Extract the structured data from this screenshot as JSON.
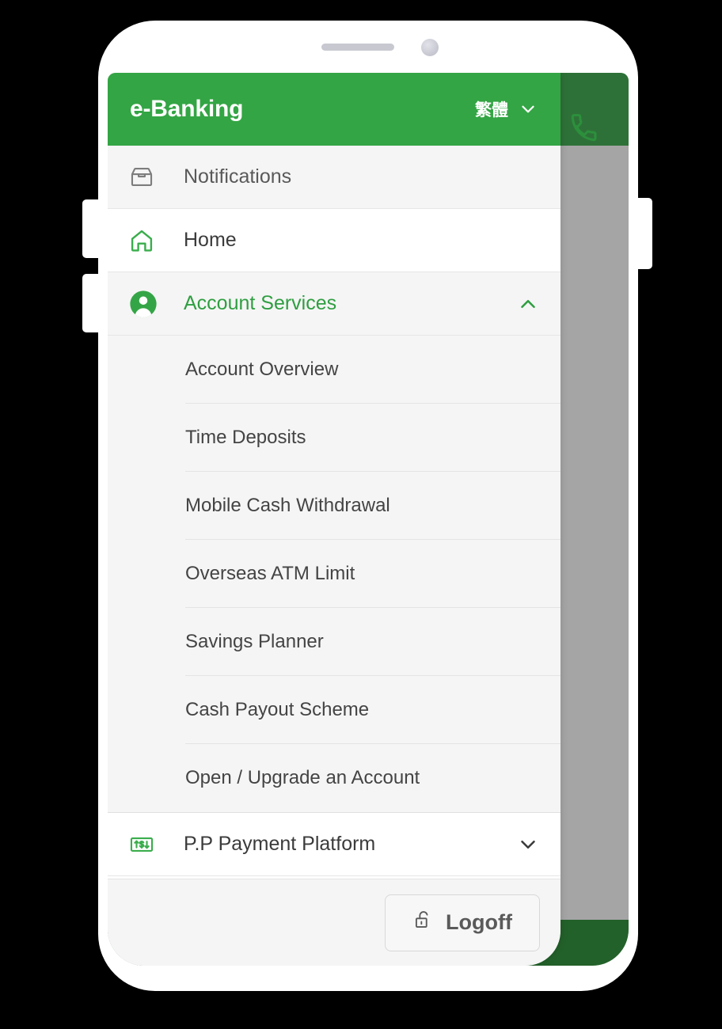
{
  "app": {
    "brand": "e-Banking",
    "language": {
      "label": "繁體",
      "chevron_icon": "chevron-down-icon"
    },
    "accent_color": "#33a544",
    "accent_color_dark": "#1f8a2b"
  },
  "behind": {
    "call_icon": "phone-icon"
  },
  "nav": [
    {
      "label": "Notifications",
      "icon": "inbox-icon",
      "state": "tinted",
      "expandable": false
    },
    {
      "label": "Home",
      "icon": "home-icon",
      "state": "plain",
      "expandable": false
    },
    {
      "label": "Account Services",
      "icon": "account-avatar-icon",
      "state": "active",
      "expandable": true,
      "expanded": true,
      "chevron_icon": "chevron-up-icon",
      "children": [
        "Account Overview",
        "Time Deposits",
        "Mobile Cash Withdrawal",
        "Overseas ATM Limit",
        "Savings Planner",
        "Cash Payout Scheme",
        "Open / Upgrade an Account"
      ]
    },
    {
      "label": "P.P Payment Platform",
      "icon": "money-transfer-icon",
      "state": "plain",
      "expandable": true,
      "expanded": false,
      "chevron_icon": "chevron-down-icon"
    }
  ],
  "footer": {
    "logoff_label": "Logoff",
    "logoff_icon": "unlock-icon"
  },
  "hardware": {
    "speaker_icon": "speaker-grille",
    "camera_icon": "front-camera",
    "volume_up": "volume-up-button",
    "volume_down": "volume-down-button",
    "power": "power-button"
  }
}
